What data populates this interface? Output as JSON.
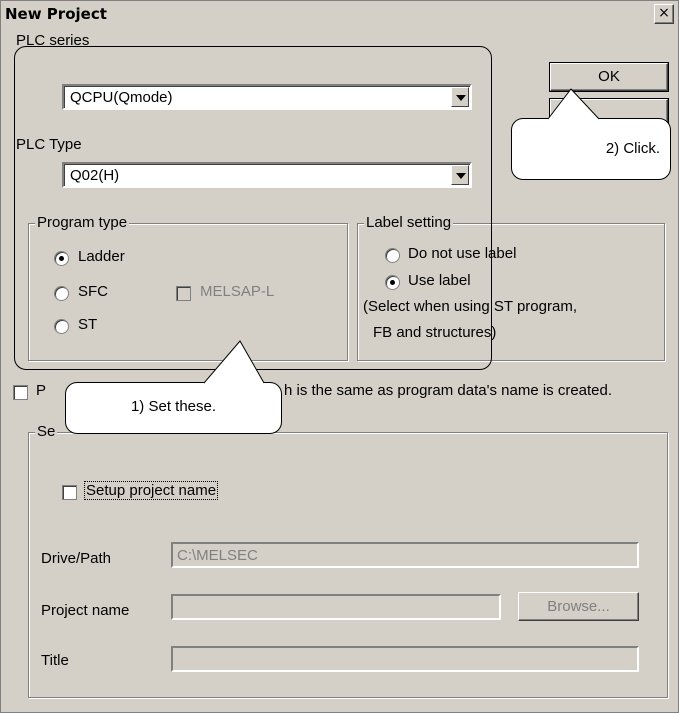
{
  "dialog": {
    "title": "New Project",
    "close_glyph": "×"
  },
  "plc_series": {
    "label": "PLC series",
    "value": "QCPU(Qmode)"
  },
  "plc_type": {
    "label": "PLC Type",
    "value": "Q02(H)"
  },
  "program_type": {
    "title": "Program type",
    "options": [
      "Ladder",
      "SFC",
      "ST"
    ],
    "selected": "Ladder",
    "melsap_label": "MELSAP-L"
  },
  "label_setting": {
    "title": "Label setting",
    "options": [
      "Do not use label",
      "Use label"
    ],
    "selected": "Use label",
    "note_line1": "(Select when using ST program,",
    "note_line2": "FB and structures)"
  },
  "buttons": {
    "ok": "OK",
    "browse": "Browse..."
  },
  "option_row": {
    "start": "P",
    "end": "h is the same as program data's name is created."
  },
  "setup_group": {
    "title_fragment": "Se",
    "setup_project_name": "Setup project name",
    "drive_path_label": "Drive/Path",
    "drive_path_value": "C:\\MELSEC",
    "project_name_label": "Project name",
    "title_label": "Title"
  },
  "callouts": {
    "set_these": "1) Set these.",
    "click": "2) Click."
  }
}
